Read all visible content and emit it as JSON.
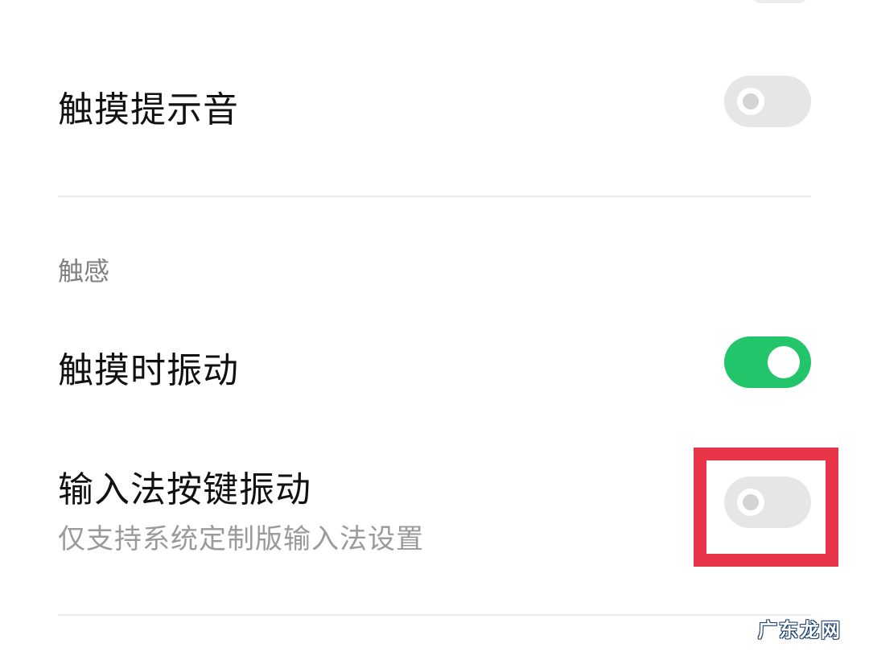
{
  "settings": {
    "touch_sound": {
      "label": "触摸提示音",
      "enabled": false
    },
    "haptics_section": {
      "header": "触感"
    },
    "vibrate_on_touch": {
      "label": "触摸时振动",
      "enabled": true
    },
    "keyboard_vibration": {
      "label": "输入法按键振动",
      "description": "仅支持系统定制版输入法设置",
      "enabled": false
    }
  },
  "colors": {
    "toggle_on": "#23c56b",
    "toggle_off": "#e6e6e6",
    "highlight": "#e8354a"
  },
  "watermark": "广东龙网"
}
